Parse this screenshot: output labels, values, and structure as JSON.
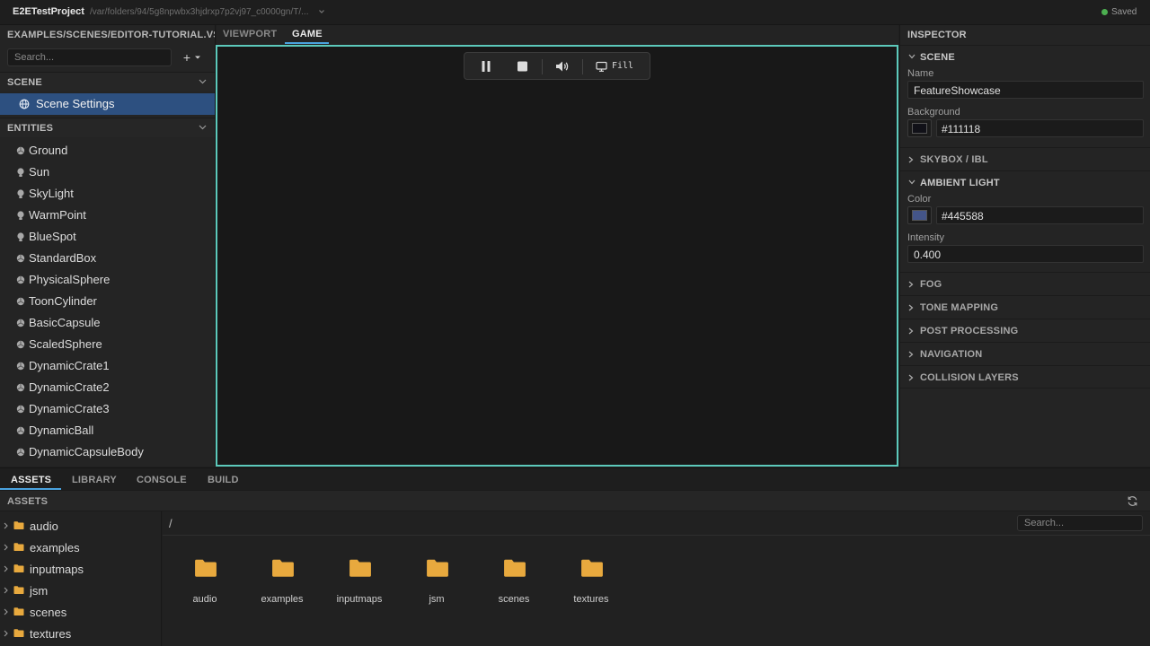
{
  "titlebar": {
    "project_name": "E2ETestProject",
    "project_path": "/var/folders/94/5g8npwbx3hjdrxp7p2vj97_c0000gn/T/...",
    "status": "Saved",
    "status_color": "#4caf50"
  },
  "left_panel": {
    "scene_path": "EXAMPLES/SCENES/EDITOR-TUTORIAL.VS",
    "search_placeholder": "Search...",
    "add_label": "+",
    "scene_section": {
      "label": "SCENE",
      "item": "Scene Settings"
    },
    "entities_section": {
      "label": "ENTITIES",
      "items": [
        {
          "label": "Ground",
          "icon": "mesh-icon"
        },
        {
          "label": "Sun",
          "icon": "light-icon"
        },
        {
          "label": "SkyLight",
          "icon": "light-icon"
        },
        {
          "label": "WarmPoint",
          "icon": "light-icon"
        },
        {
          "label": "BlueSpot",
          "icon": "light-icon"
        },
        {
          "label": "StandardBox",
          "icon": "mesh-icon"
        },
        {
          "label": "PhysicalSphere",
          "icon": "mesh-icon"
        },
        {
          "label": "ToonCylinder",
          "icon": "mesh-icon"
        },
        {
          "label": "BasicCapsule",
          "icon": "mesh-icon"
        },
        {
          "label": "ScaledSphere",
          "icon": "mesh-icon"
        },
        {
          "label": "DynamicCrate1",
          "icon": "mesh-icon"
        },
        {
          "label": "DynamicCrate2",
          "icon": "mesh-icon"
        },
        {
          "label": "DynamicCrate3",
          "icon": "mesh-icon"
        },
        {
          "label": "DynamicBall",
          "icon": "mesh-icon"
        },
        {
          "label": "DynamicCapsuleBody",
          "icon": "mesh-icon"
        }
      ]
    }
  },
  "viewport": {
    "tabs": [
      {
        "label": "VIEWPORT",
        "active": false
      },
      {
        "label": "GAME",
        "active": true
      }
    ],
    "toolbar": {
      "fill_label": "Fill",
      "icons": [
        "pause-icon",
        "stop-icon",
        "volume-icon",
        "monitor-icon"
      ]
    },
    "border_color": "#5cc9bb"
  },
  "inspector": {
    "title": "INSPECTOR",
    "scene": {
      "label": "SCENE",
      "name_label": "Name",
      "name_value": "FeatureShowcase",
      "background_label": "Background",
      "background_value": "#111118",
      "background_color": "#111118"
    },
    "skybox": {
      "label": "SKYBOX / IBL"
    },
    "ambient": {
      "label": "AMBIENT LIGHT",
      "color_label": "Color",
      "color_value": "#445588",
      "color_swatch": "#445588",
      "intensity_label": "Intensity",
      "intensity_value": "0.400"
    },
    "collapsed_sections": [
      "FOG",
      "TONE MAPPING",
      "POST PROCESSING",
      "NAVIGATION",
      "COLLISION LAYERS"
    ]
  },
  "bottom": {
    "tabs": [
      {
        "label": "ASSETS",
        "active": true
      },
      {
        "label": "LIBRARY",
        "active": false
      },
      {
        "label": "CONSOLE",
        "active": false
      },
      {
        "label": "BUILD",
        "active": false
      }
    ],
    "assets_header": "ASSETS",
    "tree": [
      "audio",
      "examples",
      "inputmaps",
      "jsm",
      "scenes",
      "textures"
    ],
    "path": "/",
    "search_placeholder": "Search...",
    "folders": [
      "audio",
      "examples",
      "inputmaps",
      "jsm",
      "scenes",
      "textures"
    ],
    "folder_color": "#e8a93e",
    "accent_color": "#4aa3df"
  }
}
